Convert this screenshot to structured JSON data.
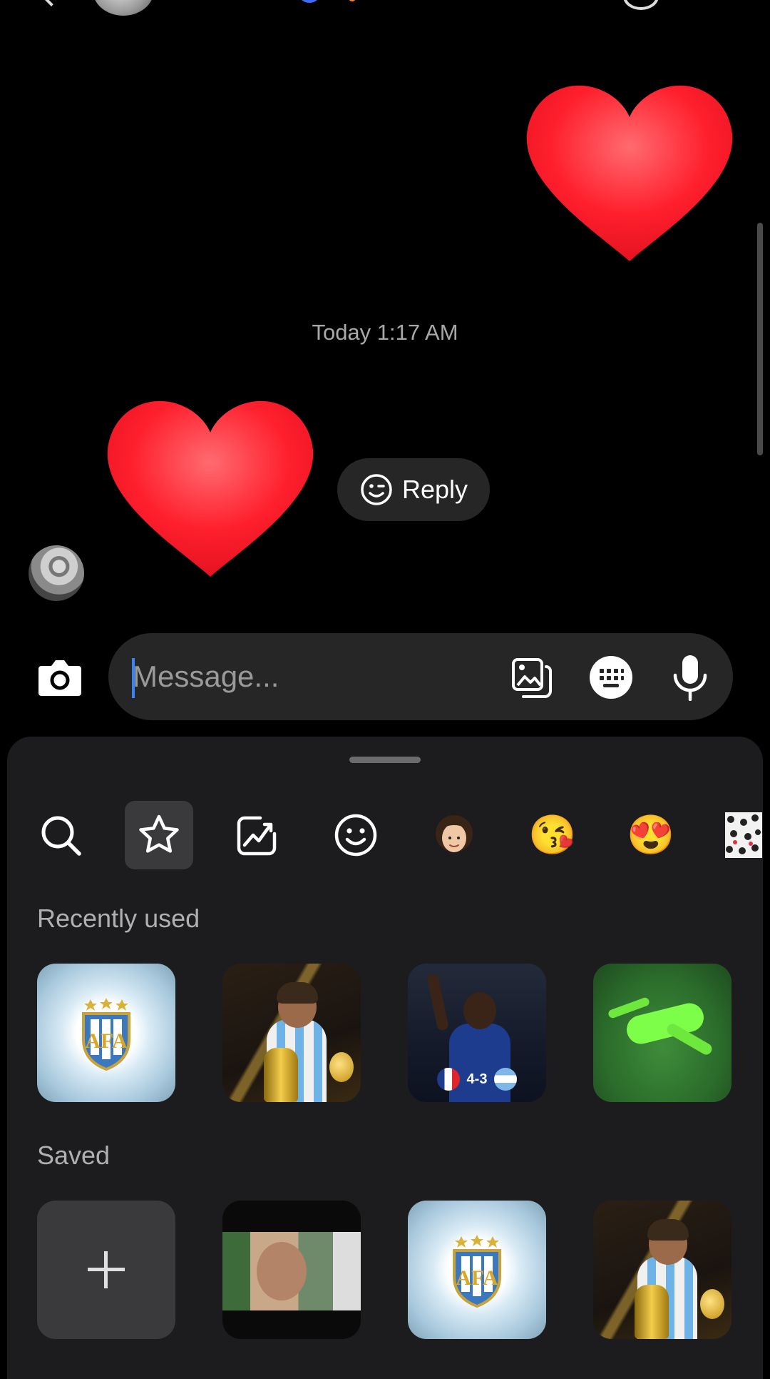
{
  "conversation": {
    "timestamp": "Today 1:17 AM",
    "sent_message": {
      "type": "heart-emoji"
    },
    "received_message": {
      "type": "heart-emoji"
    },
    "reply_label": "Reply"
  },
  "composer": {
    "placeholder": "Message...",
    "value": ""
  },
  "sticker_tray": {
    "tabs": [
      {
        "id": "search",
        "icon": "search-icon"
      },
      {
        "id": "favorites",
        "icon": "star-icon",
        "active": true
      },
      {
        "id": "trending",
        "icon": "trending-chart-icon"
      },
      {
        "id": "emoji",
        "icon": "smiley-icon"
      },
      {
        "id": "avatar",
        "icon": "avatar-face-icon"
      },
      {
        "id": "kiss-emoji",
        "icon": "kiss-face-icon",
        "glyph": "😘"
      },
      {
        "id": "flower-emoji",
        "icon": "heart-eyes-flowers-icon",
        "glyph": "😍"
      },
      {
        "id": "pattern-pack",
        "icon": "sticker-pack-icon"
      }
    ],
    "recently_used_label": "Recently used",
    "saved_label": "Saved",
    "recently_used": [
      {
        "name": "afa-crest-sticker"
      },
      {
        "name": "messi-trophy-sticker"
      },
      {
        "name": "france-player-score-sticker",
        "score": "4-3"
      },
      {
        "name": "goalkeeper-save-sticker"
      }
    ],
    "saved": [
      {
        "name": "add-sticker",
        "icon": "plus-icon"
      },
      {
        "name": "video-clip-sticker"
      },
      {
        "name": "afa-crest-sticker"
      },
      {
        "name": "messi-trophy-sticker"
      }
    ]
  },
  "colors": {
    "background": "#000000",
    "sheet": "#1c1c1e",
    "pill": "#262626",
    "caret": "#3b82f6",
    "heart": "#ff1f2d"
  }
}
